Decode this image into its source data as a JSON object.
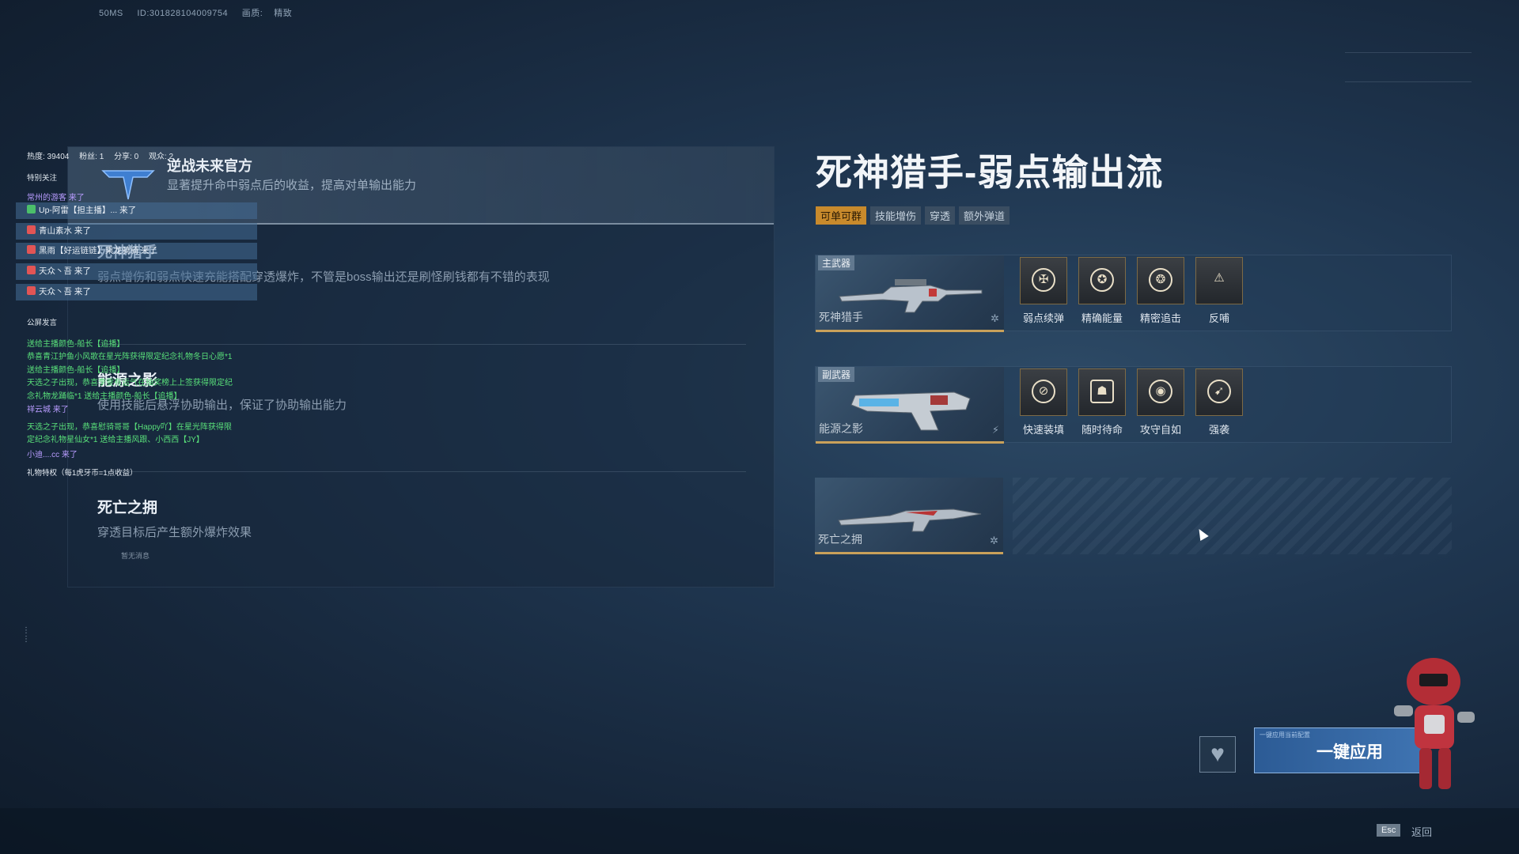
{
  "top_info": {
    "fps": "50MS",
    "id": "ID:301828104009754",
    "quality_label": "画质:",
    "quality": "精致"
  },
  "left_panel": {
    "official_title": "逆战未来官方",
    "official_desc": "显著提升命中弱点后的收益，提高对单输出能力",
    "block1": {
      "title": "死神猎手",
      "desc": "弱点增伤和弱点快速充能搭配穿透爆炸，不管是boss输出还是刷怪刷钱都有不错的表现"
    },
    "block2": {
      "title": "能源之影",
      "desc": "使用技能后悬浮协助输出，保证了协助输出能力"
    },
    "block3": {
      "title": "死亡之拥",
      "desc": "穿透目标后产生额外爆炸效果"
    }
  },
  "chat": {
    "stats": {
      "hot": "热度: 39404",
      "fans": "粉丝: 1",
      "share": "分享: 0",
      "viewers": "观众: 2"
    },
    "special_follow": "特别关注",
    "first_line": "常州的游客 来了",
    "items": [
      "Up-阿雷【担主播】... 来了",
      "青山素水 来了",
      "黑雨【好运链链】乘龙骑骑 来了",
      "天众丶吾 来了",
      "天众丶吾 来了"
    ],
    "public_label": "公屏发言",
    "messages": [
      "送给主播颜色-船长【追播】",
      "恭喜青江护鱼小风歌在星光阵获得限定纪念礼物冬日心愿*1",
      "送给主播颜色-船长【追播】",
      "天选之子出现，恭喜李雯有运气在抽奖榜上上签获得限定纪",
      "念礼物龙踊临*1 送给主播颜色-船长【追播】",
      "祥云城 来了",
      "天选之子出现，恭喜慰骑哥哥【Happy吖】在星光阵获得限",
      "定纪念礼物星仙女*1 送给主播风跟、小西西【JY】",
      "小迪....cc 来了"
    ],
    "gift_label": "礼物特权（每1虎牙币=1点收益）",
    "empty_note": "暂无消息"
  },
  "build": {
    "title": "死神猎手-弱点输出流",
    "tags": [
      {
        "label": "可单可群",
        "highlight": true
      },
      {
        "label": "技能增伤",
        "highlight": false
      },
      {
        "label": "穿透",
        "highlight": false
      },
      {
        "label": "额外弹道",
        "highlight": false
      }
    ],
    "rows": [
      {
        "badge": "主武器",
        "weapon": "死神猎手",
        "mods": [
          "弱点续弹",
          "精确能量",
          "精密追击",
          "反哺"
        ]
      },
      {
        "badge": "副武器",
        "weapon": "能源之影",
        "mods": [
          "快速装填",
          "随时待命",
          "攻守自如",
          "强袭"
        ]
      },
      {
        "badge": "",
        "weapon": "死亡之拥",
        "mods": []
      }
    ]
  },
  "actions": {
    "apply": "一键应用",
    "apply_sub": "一键应用当前配置",
    "esc": "Esc",
    "back": "返回"
  },
  "colors": {
    "accent_gold": "#c88a2c",
    "apply_blue": "#3f74b2",
    "weapon_border": "#c9a15a"
  }
}
